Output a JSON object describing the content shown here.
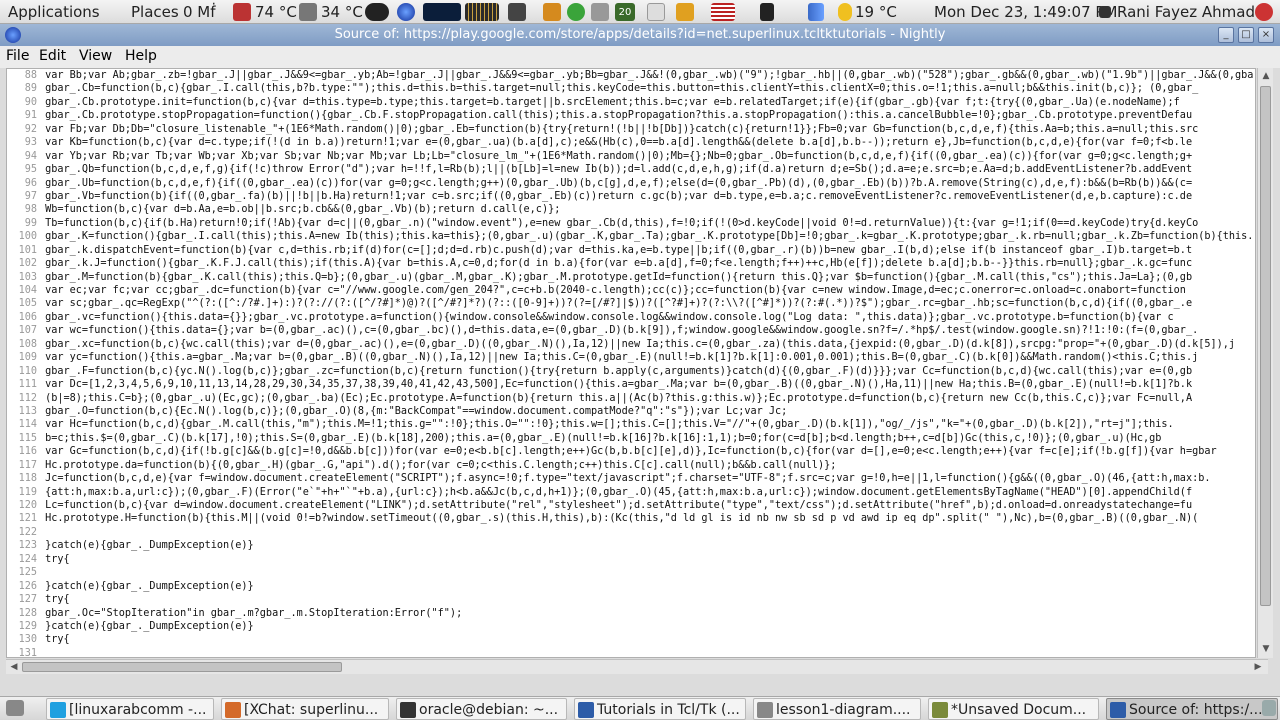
{
  "topbar": {
    "applications": "Applications",
    "places": "Places",
    "places_extra": "0 Mḟ",
    "temp1": "74 °C",
    "temp2": "34 °C",
    "cal_day": "20",
    "weather": "19 °C",
    "datetime": "Mon Dec 23,  1:49:07 PM",
    "user": "Rani Fayez Ahmad"
  },
  "window": {
    "title": "Source of: https://play.google.com/store/apps/details?id=net.superlinux.tcltktutorials - Nightly",
    "min": "_",
    "max": "□",
    "close": "×"
  },
  "menu": {
    "file": "File",
    "edit": "Edit",
    "view": "View",
    "help": "Help"
  },
  "code_lines": [
    {
      "n": "88",
      "t": "var Bb;var Ab;gbar_.zb=!gbar_.J||gbar_.J&&9<=gbar_.yb;Ab=!gbar_.J||gbar_.J&&9<=gbar_.yb;Bb=gbar_.J&&!(0,gbar_.wb)(\"9\");!gbar_.hb||(0,gbar_.wb)(\"528\");gbar_.gb&&(0,gbar_.wb)(\"1.9b\")||gbar_.J&&(0,gbar_.wb)"
    },
    {
      "n": "89",
      "t": "gbar_.Cb=function(b,c){gbar_.I.call(this,b?b.type:\"\");this.d=this.b=this.target=null;this.keyCode=this.button=this.clientY=this.clientX=0;this.o=!1;this.a=null;b&&this.init(b,c)}; (0,gbar_"
    },
    {
      "n": "90",
      "t": "gbar_.Cb.prototype.init=function(b,c){var d=this.type=b.type;this.target=b.target||b.srcElement;this.b=c;var e=b.relatedTarget;if(e){if(gbar_.gb){var f;t:{try{(0,gbar_.Ua)(e.nodeName);f"
    },
    {
      "n": "91",
      "t": "gbar_.Cb.prototype.stopPropagation=function(){gbar_.Cb.F.stopPropagation.call(this);this.a.stopPropagation?this.a.stopPropagation():this.a.cancelBubble=!0};gbar_.Cb.prototype.preventDefau"
    },
    {
      "n": "92",
      "t": "var Fb;var Db;Db=\"closure_listenable_\"+(1E6*Math.random()|0);gbar_.Eb=function(b){try{return!(!b||!b[Db])}catch(c){return!1}};Fb=0;var Gb=function(b,c,d,e,f){this.Aa=b;this.a=null;this.src"
    },
    {
      "n": "93",
      "t": "var Kb=function(b,c){var d=c.type;if(!(d in b.a))return!1;var e=(0,gbar_.ua)(b.a[d],c);e&&(Hb(c),0==b.a[d].length&&(delete b.a[d],b.b--));return e},Jb=function(b,c,d,e){for(var f=0;f<b.le"
    },
    {
      "n": "94",
      "t": "var Yb;var Rb;var Tb;var Wb;var Xb;var Sb;var Nb;var Mb;var Lb;Lb=\"closure_lm_\"+(1E6*Math.random()|0);Mb={};Nb=0;gbar_.Ob=function(b,c,d,e,f){if((0,gbar_.ea)(c)){for(var g=0;g<c.length;g+"
    },
    {
      "n": "95",
      "t": "gbar_.Qb=function(b,c,d,e,f,g){if(!c)throw Error(\"d\");var h=!!f,l=Rb(b);l||(b[Lb]=l=new Ib(b));d=l.add(c,d,e,h,g);if(d.a)return d;e=Sb();d.a=e;e.src=b;e.Aa=d;b.addEventListener?b.addEvent"
    },
    {
      "n": "96",
      "t": "gbar_.Ub=function(b,c,d,e,f){if((0,gbar_.ea)(c))for(var g=0;g<c.length;g++)(0,gbar_.Ub)(b,c[g],d,e,f);else(d=(0,gbar_.Pb)(d),(0,gbar_.Eb)(b))?b.A.remove(String(c),d,e,f):b&&(b=Rb(b))&&(c="
    },
    {
      "n": "97",
      "t": "gbar_.Vb=function(b){if((0,gbar_.fa)(b)||!b||b.Ha)return!1;var c=b.src;if((0,gbar_.Eb)(c))return c.gc(b);var d=b.type,e=b.a;c.removeEventListener?c.removeEventListener(d,e,b.capture):c.de"
    },
    {
      "n": "98",
      "t": "Wb=function(b,c){var d=b.Aa,e=b.ob||b.src;b.cb&&(0,gbar_.Vb)(b);return d.call(e,c)};"
    },
    {
      "n": "99",
      "t": "Tb=function(b,c){if(b.Ha)return!0;if(!Ab){var d=c||(0,gbar_.n)(\"window.event\"),e=new gbar_.Cb(d,this),f=!0;if(!(0>d.keyCode||void 0!=d.returnValue)){t:{var g=!1;if(0==d.keyCode)try{d.keyCo"
    },
    {
      "n": "100",
      "t": "gbar_.K=function(){gbar_.I.call(this);this.A=new Ib(this);this.ka=this};(0,gbar_.u)(gbar_.K,gbar_.Ta);gbar_.K.prototype[Db]=!0;gbar_.k=gbar_.K.prototype;gbar_.k.rb=null;gbar_.k.Zb=function(b){this.rb=b};gba"
    },
    {
      "n": "101",
      "t": "gbar_.k.dispatchEvent=function(b){var c,d=this.rb;if(d)for(c=[];d;d=d.rb)c.push(d);var d=this.ka,e=b.type||b;if((0,gbar_.r)(b))b=new gbar_.I(b,d);else if(b instanceof gbar_.I)b.target=b.t"
    },
    {
      "n": "102",
      "t": "gbar_.k.J=function(){gbar_.K.F.J.call(this);if(this.A){var b=this.A,c=0,d;for(d in b.a){for(var e=b.a[d],f=0;f<e.length;f++)++c,Hb(e[f]);delete b.a[d];b.b--}}this.rb=null};gbar_.k.gc=func"
    },
    {
      "n": "103",
      "t": "gbar_.M=function(b){gbar_.K.call(this);this.Q=b};(0,gbar_.u)(gbar_.M,gbar_.K);gbar_.M.prototype.getId=function(){return this.Q};var $b=function(){gbar_.M.call(this,\"cs\");this.Ja=La};(0,gb"
    },
    {
      "n": "104",
      "t": "var ec;var fc;var cc;gbar_.dc=function(b){var c=\"//www.google.com/gen_204?\",c=c+b.b(2040-c.length);cc(c)};cc=function(b){var c=new window.Image,d=ec;c.onerror=c.onload=c.onabort=function"
    },
    {
      "n": "105",
      "t": "var sc;gbar_.qc=RegExp(\"^(?:([^:/?#.]+):)?(?://(?:([^/?#]*)@)?([^/#?]*?)(?::([0-9]+))?(?=[/#?]|$))?([^?#]+)?(?:\\\\?([^#]*))?(?:#(.*))?$\");gbar_.rc=gbar_.hb;sc=function(b,c,d){if((0,gbar_.e"
    },
    {
      "n": "106",
      "t": "gbar_.vc=function(){this.data={}};gbar_.vc.prototype.a=function(){window.console&&window.console.log&&window.console.log(\"Log data: \",this.data)};gbar_.vc.prototype.b=function(b){var c"
    },
    {
      "n": "107",
      "t": "var wc=function(){this.data={};var b=(0,gbar_.ac)(),c=(0,gbar_.bc)(),d=this.data,e=(0,gbar_.D)(b.k[9]),f;window.google&&window.google.sn?f=/.*hp$/.test(window.google.sn)?!1:!0:(f=(0,gbar_."
    },
    {
      "n": "108",
      "t": "gbar_.xc=function(b,c){wc.call(this);var d=(0,gbar_.ac)(),e=(0,gbar_.D)((0,gbar_.N)(),Ia,12)||new Ia;this.c=(0,gbar_.za)(this.data,{jexpid:(0,gbar_.D)(d.k[8]),srcpg:\"prop=\"+(0,gbar_.D)(d.k[5]),j"
    },
    {
      "n": "109",
      "t": "var yc=function(){this.a=gbar_.Ma;var b=(0,gbar_.B)((0,gbar_.N)(),Ia,12)||new Ia;this.C=(0,gbar_.E)(null!=b.k[1]?b.k[1]:0.001,0.001);this.B=(0,gbar_.C)(b.k[0])&&Math.random()<this.C;this.j"
    },
    {
      "n": "110",
      "t": "gbar_.F=function(b,c){yc.N().log(b,c)};gbar_.zc=function(b,c){return function(){try{return b.apply(c,arguments)}catch(d){(0,gbar_.F)(d)}}};var Cc=function(b,c,d){wc.call(this);var e=(0,gb"
    },
    {
      "n": "111",
      "t": "var Dc=[1,2,3,4,5,6,9,10,11,13,14,28,29,30,34,35,37,38,39,40,41,42,43,500],Ec=function(){this.a=gbar_.Ma;var b=(0,gbar_.B)((0,gbar_.N)(),Ha,11)||new Ha;this.B=(0,gbar_.E)(null!=b.k[1]?b.k"
    },
    {
      "n": "112",
      "t": "(b|=8);this.C=b};(0,gbar_.u)(Ec,gc);(0,gbar_.ba)(Ec);Ec.prototype.A=function(b){return this.a||(Ac(b)?this.g:this.w)};Ec.prototype.d=function(b,c){return new Cc(b,this.C,c)};var Fc=null,A"
    },
    {
      "n": "113",
      "t": "gbar_.O=function(b,c){Ec.N().log(b,c)};(0,gbar_.O)(8,{m:\"BackCompat\"==window.document.compatMode?\"q\":\"s\"});var Lc;var Jc;"
    },
    {
      "n": "114",
      "t": "var Hc=function(b,c,d){gbar_.M.call(this,\"m\");this.M=!1;this.g=\"\":!0};this.O=\"\":!0};this.w=[];this.C=[];this.V=\"//\"+(0,gbar_.D)(b.k[1]),\"og/_/js\",\"k=\"+(0,gbar_.D)(b.k[2]),\"rt=j\"];this."
    },
    {
      "n": "115",
      "t": "b=c;this.$=(0,gbar_.C)(b.k[17],!0);this.S=(0,gbar_.E)(b.k[18],200);this.a=(0,gbar_.E)(null!=b.k[16]?b.k[16]:1,1);b=0;for(c=d[b];b<d.length;b++,c=d[b])Gc(this,c,!0)};(0,gbar_.u)(Hc,gb"
    },
    {
      "n": "116",
      "t": "var Gc=function(b,c,d){if(!b.g[c]&&(b.g[c]=!0,d&&b.b[c]))for(var e=0;e<b.b[c].length;e++)Gc(b,b.b[c][e],d)},Ic=function(b,c){for(var d=[],e=0;e<c.length;e++){var f=c[e];if(!b.g[f]){var h=gbar"
    },
    {
      "n": "117",
      "t": "Hc.prototype.da=function(b){(0,gbar_.H)(gbar_.G,\"api\").d();for(var c=0;c<this.C.length;c++)this.C[c].call(null);b&&b.call(null)};"
    },
    {
      "n": "118",
      "t": "Jc=function(b,c,d,e){var f=window.document.createElement(\"SCRIPT\");f.async=!0;f.type=\"text/javascript\";f.charset=\"UTF-8\";f.src=c;var g=!0,h=e||1,l=function(){g&&((0,gbar_.O)(46,{att:h,max:b."
    },
    {
      "n": "119",
      "t": "{att:h,max:b.a,url:c});(0,gbar_.F)(Error(\"e`\"+h+\"`\"+b.a),{url:c});h<b.a&&Jc(b,c,d,h+1)};(0,gbar_.O)(45,{att:h,max:b.a,url:c});window.document.getElementsByTagName(\"HEAD\")[0].appendChild(f"
    },
    {
      "n": "120",
      "t": "Lc=function(b,c){var d=window.document.createElement(\"LINK\");d.setAttribute(\"rel\",\"stylesheet\");d.setAttribute(\"type\",\"text/css\");d.setAttribute(\"href\",b);d.onload=d.onreadystatechange=fu"
    },
    {
      "n": "121",
      "t": "Hc.prototype.H=function(b){this.M||(void 0!=b?window.setTimeout((0,gbar_.s)(this.H,this),b):(Kc(this,\"d ld gl is id nb nw sb sd p vd awd ip eq dp\".split(\" \"),Nc),b=(0,gbar_.B)((0,gbar_.N)("
    },
    {
      "n": "122",
      "t": ""
    },
    {
      "n": "123",
      "t": "}catch(e){gbar_._DumpException(e)}"
    },
    {
      "n": "124",
      "t": "try{"
    },
    {
      "n": "125",
      "t": ""
    },
    {
      "n": "126",
      "t": "}catch(e){gbar_._DumpException(e)}"
    },
    {
      "n": "127",
      "t": "try{"
    },
    {
      "n": "128",
      "t": "gbar_.Oc=\"StopIteration\"in gbar_.m?gbar_.m.StopIteration:Error(\"f\");"
    },
    {
      "n": "129",
      "t": "}catch(e){gbar_._DumpException(e)}"
    },
    {
      "n": "130",
      "t": "try{"
    },
    {
      "n": "131",
      "t": ""
    }
  ],
  "taskbar": [
    {
      "label": "[linuxarabcomm -...",
      "icon": "skype-icon",
      "color": "#1fa0e0"
    },
    {
      "label": "[XChat: superlinu...",
      "icon": "xchat-icon",
      "color": "#d46a2a"
    },
    {
      "label": "oracle@debian: ~...",
      "icon": "terminal-icon",
      "color": "#333333"
    },
    {
      "label": "Tutorials in Tcl/Tk (...",
      "icon": "firefox-icon",
      "color": "#2d5ca8"
    },
    {
      "label": "lesson1-diagram....",
      "icon": "image-icon",
      "color": "#888888"
    },
    {
      "label": "*Unsaved Docum...",
      "icon": "editor-icon",
      "color": "#7a8a3a"
    },
    {
      "label": "Source of: https:/...",
      "icon": "firefox-icon",
      "color": "#2d5ca8"
    }
  ]
}
